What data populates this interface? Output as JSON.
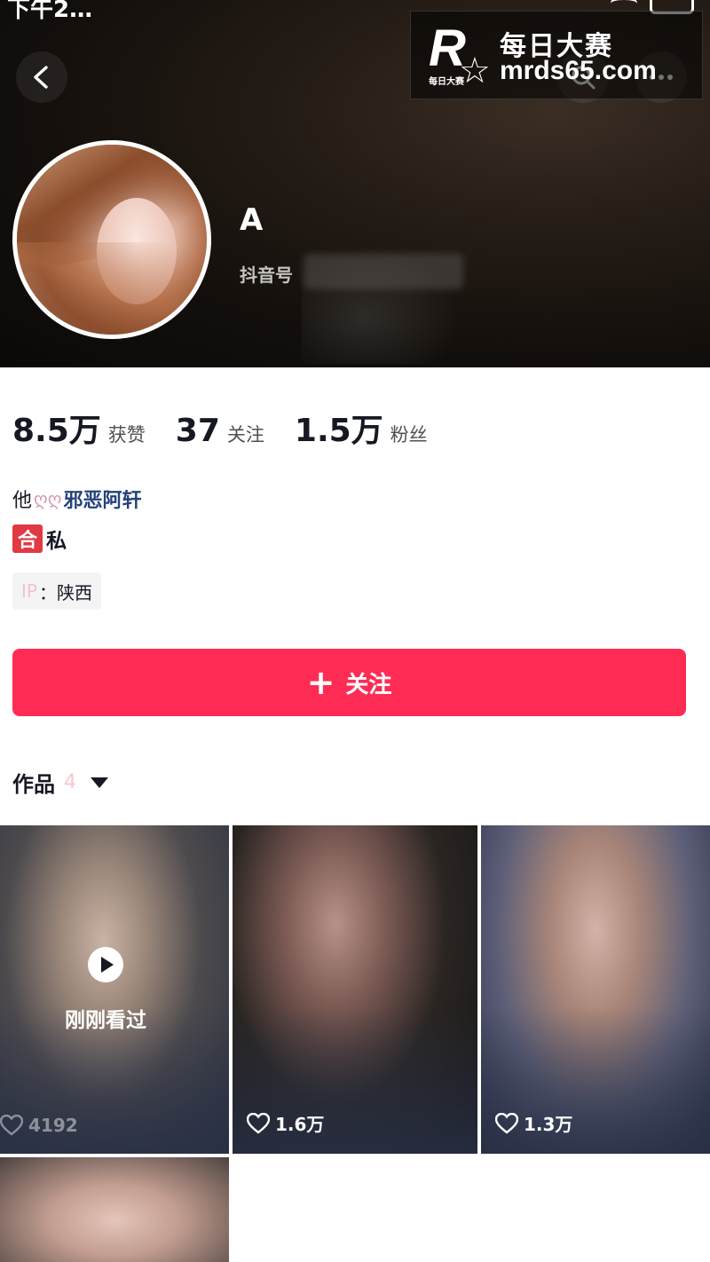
{
  "status_bar": {
    "time": "下午2…"
  },
  "watermark": {
    "logo_letter": "R",
    "logo_small": "每日大赛",
    "line1": "每日大赛",
    "line2": "mrds65.com"
  },
  "profile": {
    "name": "A",
    "id_label": "抖音号"
  },
  "stats": [
    {
      "value": "8.5万",
      "label": "获赞"
    },
    {
      "value": "37",
      "label": "关注"
    },
    {
      "value": "1.5万",
      "label": "粉丝"
    }
  ],
  "bio": {
    "line1_prefix": "他",
    "line1_hearts": "ღღ",
    "line1_name": "邪恶阿轩",
    "badge": "合",
    "line2_text": "私"
  },
  "ip": {
    "label": "IP",
    "value": "：陕西"
  },
  "follow_button": {
    "icon": "plus-icon",
    "label": "关注"
  },
  "works_tab": {
    "label": "作品",
    "count": "4"
  },
  "videos": [
    {
      "overlay": "刚刚看过",
      "likes": "4192"
    },
    {
      "likes": "1.6万"
    },
    {
      "likes": "1.3万"
    },
    {
      "likes": ""
    }
  ],
  "colors": {
    "accent": "#fe2c55",
    "badge": "#e03a44",
    "link": "#26427a"
  }
}
